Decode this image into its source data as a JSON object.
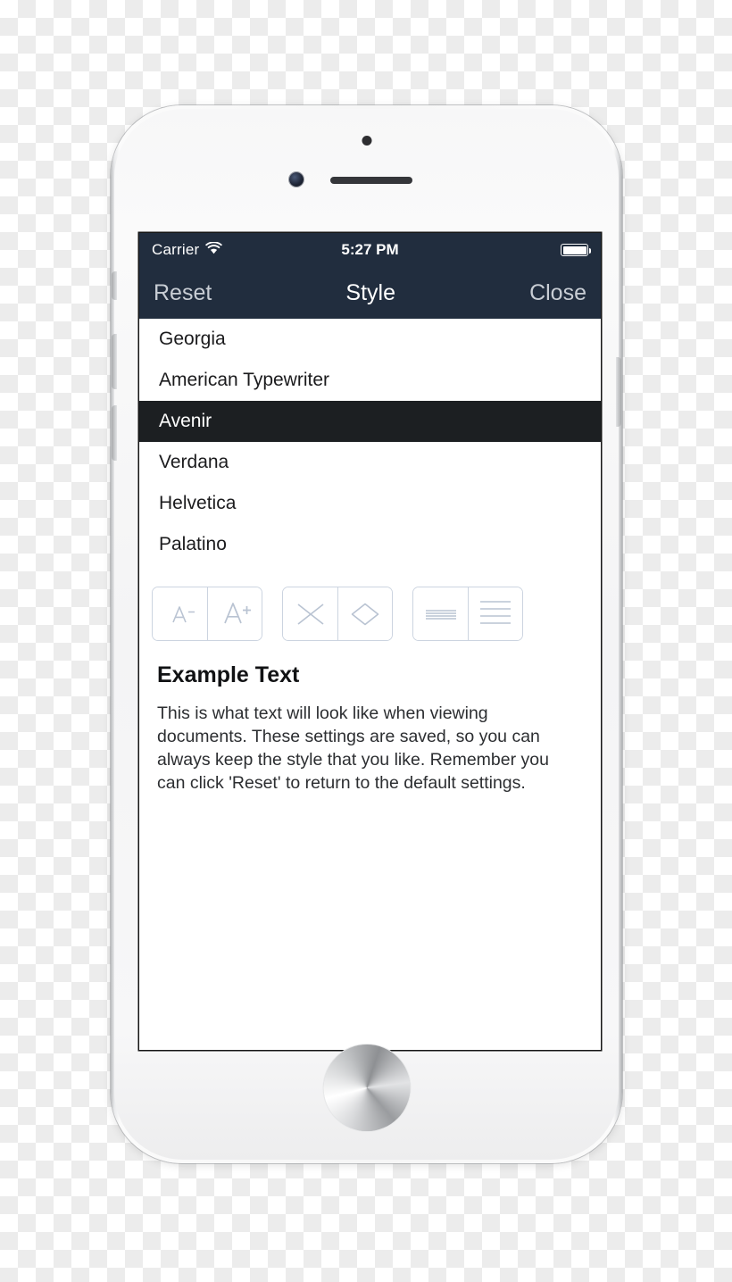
{
  "device": {
    "name": "white-iphone-mockup",
    "hardware": {
      "sensor": "proximity-sensor",
      "camera": "front-camera",
      "speaker": "earpiece-speaker",
      "home": "home-button",
      "mute_switch": "mute-switch",
      "volume_up": "volume-up-button",
      "volume_down": "volume-down-button",
      "power": "power-button"
    }
  },
  "status_bar": {
    "carrier": "Carrier",
    "wifi_icon": "wifi-icon",
    "time": "5:27 PM",
    "battery_icon": "battery-full-icon",
    "battery_level": 100,
    "background": "#212d3e"
  },
  "nav_bar": {
    "left_button": "Reset",
    "title": "Style",
    "right_button": "Close",
    "background": "#212d3e",
    "title_color": "#ffffff",
    "button_color": "#c8cdd4"
  },
  "font_list": {
    "selected": "Avenir",
    "selected_background": "#1c1f22",
    "items": [
      {
        "label": "Georgia",
        "selected": false
      },
      {
        "label": "American Typewriter",
        "selected": false
      },
      {
        "label": "Avenir",
        "selected": true
      },
      {
        "label": "Verdana",
        "selected": false
      },
      {
        "label": "Helvetica",
        "selected": false
      },
      {
        "label": "Palatino",
        "selected": false
      }
    ]
  },
  "controls": {
    "accent": "#ccd4e0",
    "groups": [
      {
        "name": "font-size-group",
        "buttons": [
          {
            "icon": "decrease-font-size-icon",
            "label": "A-"
          },
          {
            "icon": "increase-font-size-icon",
            "label": "A+"
          }
        ]
      },
      {
        "name": "margin-width-group",
        "buttons": [
          {
            "icon": "narrow-margins-icon",
            "label": "X"
          },
          {
            "icon": "wide-margins-icon",
            "label": "Diamond"
          }
        ]
      },
      {
        "name": "line-spacing-group",
        "buttons": [
          {
            "icon": "tight-line-spacing-icon",
            "label": "Tight"
          },
          {
            "icon": "loose-line-spacing-icon",
            "label": "Loose"
          }
        ]
      }
    ]
  },
  "example": {
    "heading": "Example Text",
    "body": "This is what text will look like when viewing documents. These settings are saved, so you can always keep the style that you like. Remember you can click 'Reset' to return to the default settings."
  }
}
